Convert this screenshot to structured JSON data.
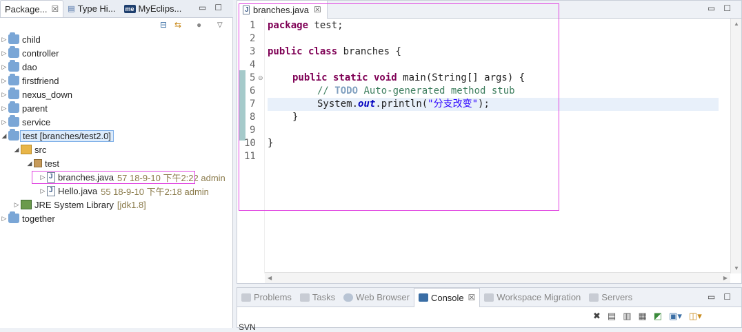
{
  "left_tabs": [
    {
      "label": "Package...",
      "close": "☒",
      "active": true
    },
    {
      "label": "Type Hi..."
    },
    {
      "label": "MyEclips...",
      "badge": "me"
    }
  ],
  "window_controls": {
    "minimize": "▭",
    "maximize": "☐"
  },
  "toolbar_icons": [
    "collapse-all-icon",
    "link-with-editor-icon",
    "filter-icon",
    "view-menu-icon"
  ],
  "tree": [
    {
      "label": "child"
    },
    {
      "label": "controller"
    },
    {
      "label": "dao"
    },
    {
      "label": "firstfriend"
    },
    {
      "label": "nexus_down"
    },
    {
      "label": "parent"
    },
    {
      "label": "service"
    },
    {
      "label": "test [branches/test2.0]"
    },
    {
      "label": "src"
    },
    {
      "label": "test"
    },
    {
      "label": "branches.java",
      "decoration": "57  18-9-10 下午2:22  admin"
    },
    {
      "label": "Hello.java",
      "decoration": "55  18-9-10 下午2:18  admin"
    },
    {
      "label": "JRE System Library",
      "decoration": "[jdk1.8]"
    },
    {
      "label": "together"
    }
  ],
  "editor": {
    "tab_label": "branches.java",
    "tab_close": "☒",
    "line_numbers": [
      "1",
      "2",
      "3",
      "4",
      "5",
      "6",
      "7",
      "8",
      "9",
      "10",
      "11"
    ],
    "code": {
      "l1_kw": "package",
      "l1_rest": " test;",
      "l3_kw": "public class",
      "l3_rest": " branches {",
      "l5_kw": "public static void",
      "l5_rest": " main(String[] args) {",
      "l6_cm1": "// ",
      "l6_todo": "TODO",
      "l6_cm2": " Auto-generated method stub",
      "l7_a": "System.",
      "l7_field": "out",
      "l7_b": ".println(",
      "l7_str": "\"分支改变\"",
      "l7_c": ");",
      "l8": "}",
      "l10": "}"
    }
  },
  "bottom_tabs": [
    {
      "label": "Problems"
    },
    {
      "label": "Tasks"
    },
    {
      "label": "Web Browser"
    },
    {
      "label": "Console",
      "active": true,
      "close": "☒"
    },
    {
      "label": "Workspace Migration"
    },
    {
      "label": "Servers"
    }
  ],
  "console_text": "SVN",
  "colors": {
    "highlight_box": "#e040e0",
    "keyword": "#7f0055",
    "comment": "#3f7f5f",
    "string": "#2a00ff"
  }
}
